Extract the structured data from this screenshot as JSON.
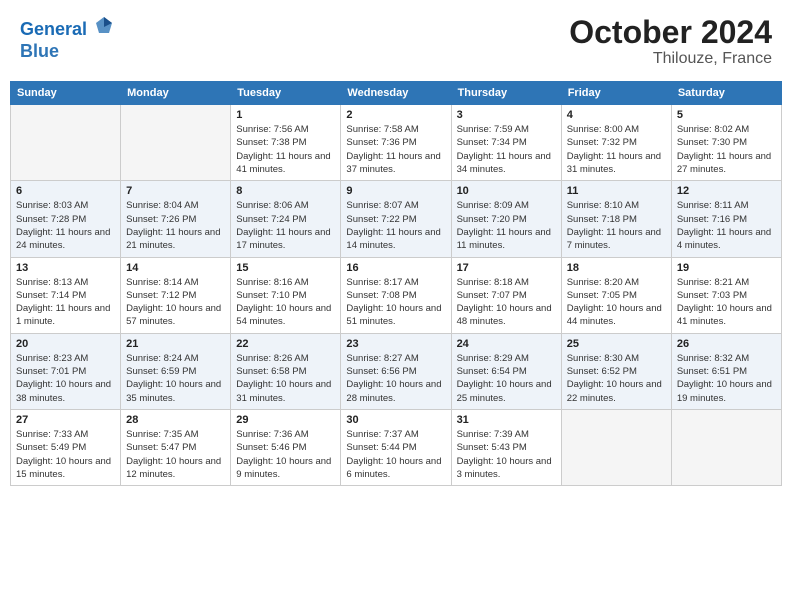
{
  "header": {
    "logo_line1": "General",
    "logo_line2": "Blue",
    "month": "October 2024",
    "location": "Thilouze, France"
  },
  "weekdays": [
    "Sunday",
    "Monday",
    "Tuesday",
    "Wednesday",
    "Thursday",
    "Friday",
    "Saturday"
  ],
  "weeks": [
    [
      {
        "day": "",
        "info": ""
      },
      {
        "day": "",
        "info": ""
      },
      {
        "day": "1",
        "info": "Sunrise: 7:56 AM\nSunset: 7:38 PM\nDaylight: 11 hours and 41 minutes."
      },
      {
        "day": "2",
        "info": "Sunrise: 7:58 AM\nSunset: 7:36 PM\nDaylight: 11 hours and 37 minutes."
      },
      {
        "day": "3",
        "info": "Sunrise: 7:59 AM\nSunset: 7:34 PM\nDaylight: 11 hours and 34 minutes."
      },
      {
        "day": "4",
        "info": "Sunrise: 8:00 AM\nSunset: 7:32 PM\nDaylight: 11 hours and 31 minutes."
      },
      {
        "day": "5",
        "info": "Sunrise: 8:02 AM\nSunset: 7:30 PM\nDaylight: 11 hours and 27 minutes."
      }
    ],
    [
      {
        "day": "6",
        "info": "Sunrise: 8:03 AM\nSunset: 7:28 PM\nDaylight: 11 hours and 24 minutes."
      },
      {
        "day": "7",
        "info": "Sunrise: 8:04 AM\nSunset: 7:26 PM\nDaylight: 11 hours and 21 minutes."
      },
      {
        "day": "8",
        "info": "Sunrise: 8:06 AM\nSunset: 7:24 PM\nDaylight: 11 hours and 17 minutes."
      },
      {
        "day": "9",
        "info": "Sunrise: 8:07 AM\nSunset: 7:22 PM\nDaylight: 11 hours and 14 minutes."
      },
      {
        "day": "10",
        "info": "Sunrise: 8:09 AM\nSunset: 7:20 PM\nDaylight: 11 hours and 11 minutes."
      },
      {
        "day": "11",
        "info": "Sunrise: 8:10 AM\nSunset: 7:18 PM\nDaylight: 11 hours and 7 minutes."
      },
      {
        "day": "12",
        "info": "Sunrise: 8:11 AM\nSunset: 7:16 PM\nDaylight: 11 hours and 4 minutes."
      }
    ],
    [
      {
        "day": "13",
        "info": "Sunrise: 8:13 AM\nSunset: 7:14 PM\nDaylight: 11 hours and 1 minute."
      },
      {
        "day": "14",
        "info": "Sunrise: 8:14 AM\nSunset: 7:12 PM\nDaylight: 10 hours and 57 minutes."
      },
      {
        "day": "15",
        "info": "Sunrise: 8:16 AM\nSunset: 7:10 PM\nDaylight: 10 hours and 54 minutes."
      },
      {
        "day": "16",
        "info": "Sunrise: 8:17 AM\nSunset: 7:08 PM\nDaylight: 10 hours and 51 minutes."
      },
      {
        "day": "17",
        "info": "Sunrise: 8:18 AM\nSunset: 7:07 PM\nDaylight: 10 hours and 48 minutes."
      },
      {
        "day": "18",
        "info": "Sunrise: 8:20 AM\nSunset: 7:05 PM\nDaylight: 10 hours and 44 minutes."
      },
      {
        "day": "19",
        "info": "Sunrise: 8:21 AM\nSunset: 7:03 PM\nDaylight: 10 hours and 41 minutes."
      }
    ],
    [
      {
        "day": "20",
        "info": "Sunrise: 8:23 AM\nSunset: 7:01 PM\nDaylight: 10 hours and 38 minutes."
      },
      {
        "day": "21",
        "info": "Sunrise: 8:24 AM\nSunset: 6:59 PM\nDaylight: 10 hours and 35 minutes."
      },
      {
        "day": "22",
        "info": "Sunrise: 8:26 AM\nSunset: 6:58 PM\nDaylight: 10 hours and 31 minutes."
      },
      {
        "day": "23",
        "info": "Sunrise: 8:27 AM\nSunset: 6:56 PM\nDaylight: 10 hours and 28 minutes."
      },
      {
        "day": "24",
        "info": "Sunrise: 8:29 AM\nSunset: 6:54 PM\nDaylight: 10 hours and 25 minutes."
      },
      {
        "day": "25",
        "info": "Sunrise: 8:30 AM\nSunset: 6:52 PM\nDaylight: 10 hours and 22 minutes."
      },
      {
        "day": "26",
        "info": "Sunrise: 8:32 AM\nSunset: 6:51 PM\nDaylight: 10 hours and 19 minutes."
      }
    ],
    [
      {
        "day": "27",
        "info": "Sunrise: 7:33 AM\nSunset: 5:49 PM\nDaylight: 10 hours and 15 minutes."
      },
      {
        "day": "28",
        "info": "Sunrise: 7:35 AM\nSunset: 5:47 PM\nDaylight: 10 hours and 12 minutes."
      },
      {
        "day": "29",
        "info": "Sunrise: 7:36 AM\nSunset: 5:46 PM\nDaylight: 10 hours and 9 minutes."
      },
      {
        "day": "30",
        "info": "Sunrise: 7:37 AM\nSunset: 5:44 PM\nDaylight: 10 hours and 6 minutes."
      },
      {
        "day": "31",
        "info": "Sunrise: 7:39 AM\nSunset: 5:43 PM\nDaylight: 10 hours and 3 minutes."
      },
      {
        "day": "",
        "info": ""
      },
      {
        "day": "",
        "info": ""
      }
    ]
  ]
}
